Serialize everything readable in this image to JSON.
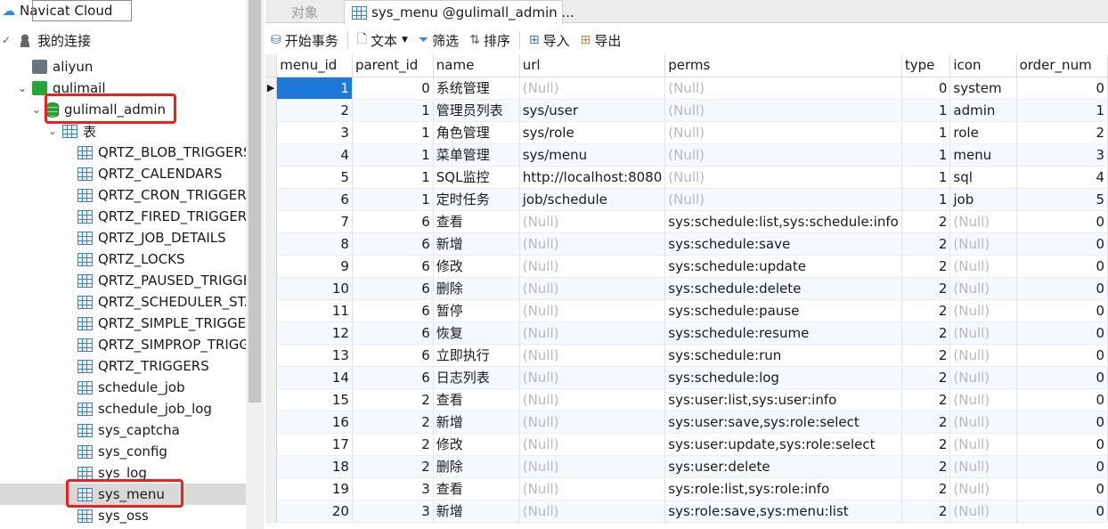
{
  "tree": {
    "cloud_label": "Navicat Cloud",
    "my_connections": "我的连接",
    "conn_aliyun": "aliyun",
    "conn_gulimail": "gulimail",
    "db_gulimall_admin": "gulimall_admin",
    "tables_node": "表",
    "tables": [
      "QRTZ_BLOB_TRIGGERS",
      "QRTZ_CALENDARS",
      "QRTZ_CRON_TRIGGERS",
      "QRTZ_FIRED_TRIGGERS",
      "QRTZ_JOB_DETAILS",
      "QRTZ_LOCKS",
      "QRTZ_PAUSED_TRIGGER_GRPS",
      "QRTZ_SCHEDULER_STATE",
      "QRTZ_SIMPLE_TRIGGERS",
      "QRTZ_SIMPROP_TRIGGERS",
      "QRTZ_TRIGGERS",
      "schedule_job",
      "schedule_job_log",
      "sys_captcha",
      "sys_config",
      "sys_log",
      "sys_menu",
      "sys_oss"
    ]
  },
  "tabs": {
    "objects": "对象",
    "sys_menu": "sys_menu @gulimall_admin ..."
  },
  "toolbar": {
    "begin_tx": "开始事务",
    "text": "文本",
    "filter": "筛选",
    "sort": "排序",
    "import": "导入",
    "export": "导出"
  },
  "grid": {
    "columns": [
      "menu_id",
      "parent_id",
      "name",
      "url",
      "perms",
      "type",
      "icon",
      "order_num"
    ],
    "null_text": "(Null)",
    "rows": [
      [
        "1",
        "0",
        "系统管理",
        null,
        null,
        "0",
        "system",
        "0"
      ],
      [
        "2",
        "1",
        "管理员列表",
        "sys/user",
        null,
        "1",
        "admin",
        "1"
      ],
      [
        "3",
        "1",
        "角色管理",
        "sys/role",
        null,
        "1",
        "role",
        "2"
      ],
      [
        "4",
        "1",
        "菜单管理",
        "sys/menu",
        null,
        "1",
        "menu",
        "3"
      ],
      [
        "5",
        "1",
        "SQL监控",
        "http://localhost:8080",
        null,
        "1",
        "sql",
        "4"
      ],
      [
        "6",
        "1",
        "定时任务",
        "job/schedule",
        null,
        "1",
        "job",
        "5"
      ],
      [
        "7",
        "6",
        "查看",
        null,
        "sys:schedule:list,sys:schedule:info",
        "2",
        null,
        "0"
      ],
      [
        "8",
        "6",
        "新增",
        null,
        "sys:schedule:save",
        "2",
        null,
        "0"
      ],
      [
        "9",
        "6",
        "修改",
        null,
        "sys:schedule:update",
        "2",
        null,
        "0"
      ],
      [
        "10",
        "6",
        "删除",
        null,
        "sys:schedule:delete",
        "2",
        null,
        "0"
      ],
      [
        "11",
        "6",
        "暂停",
        null,
        "sys:schedule:pause",
        "2",
        null,
        "0"
      ],
      [
        "12",
        "6",
        "恢复",
        null,
        "sys:schedule:resume",
        "2",
        null,
        "0"
      ],
      [
        "13",
        "6",
        "立即执行",
        null,
        "sys:schedule:run",
        "2",
        null,
        "0"
      ],
      [
        "14",
        "6",
        "日志列表",
        null,
        "sys:schedule:log",
        "2",
        null,
        "0"
      ],
      [
        "15",
        "2",
        "查看",
        null,
        "sys:user:list,sys:user:info",
        "2",
        null,
        "0"
      ],
      [
        "16",
        "2",
        "新增",
        null,
        "sys:user:save,sys:role:select",
        "2",
        null,
        "0"
      ],
      [
        "17",
        "2",
        "修改",
        null,
        "sys:user:update,sys:role:select",
        "2",
        null,
        "0"
      ],
      [
        "18",
        "2",
        "删除",
        null,
        "sys:user:delete",
        "2",
        null,
        "0"
      ],
      [
        "19",
        "3",
        "查看",
        null,
        "sys:role:list,sys:role:info",
        "2",
        null,
        "0"
      ],
      [
        "20",
        "3",
        "新增",
        null,
        "sys:role:save,sys:menu:list",
        "2",
        null,
        "0"
      ]
    ]
  },
  "accent": "#e8231f",
  "selection": "#1e78d7"
}
